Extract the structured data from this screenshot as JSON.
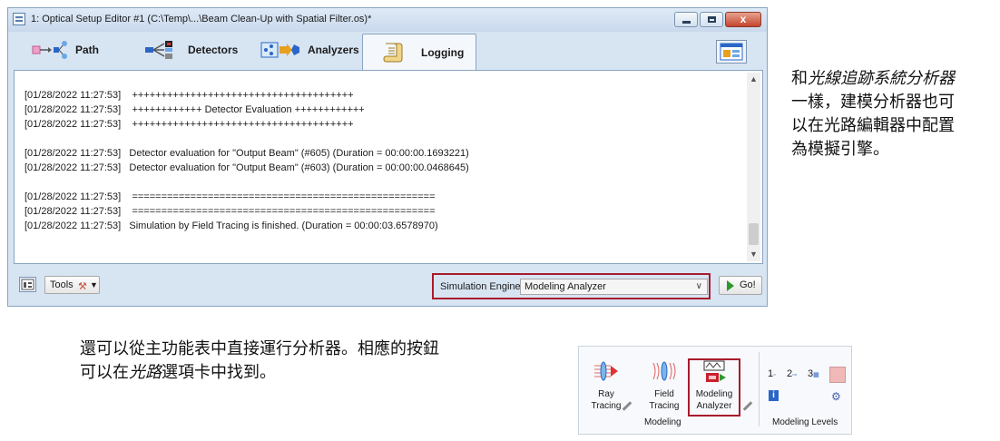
{
  "window": {
    "title": "1: Optical Setup Editor #1 (C:\\Temp\\...\\Beam Clean-Up with Spatial Filter.os)*",
    "close_glyph": "x"
  },
  "tabs": [
    {
      "label": "Path",
      "icon": "path-icon"
    },
    {
      "label": "Detectors",
      "icon": "detectors-icon"
    },
    {
      "label": "Analyzers",
      "icon": "analyzers-icon"
    },
    {
      "label": "Logging",
      "icon": "logging-scroll-icon",
      "active": true
    }
  ],
  "log": {
    "lines": [
      "[01/28/2022 11:27:53]    ++++++++++++++++++++++++++++++++++++++",
      "[01/28/2022 11:27:53]    ++++++++++++ Detector Evaluation ++++++++++++",
      "[01/28/2022 11:27:53]    ++++++++++++++++++++++++++++++++++++++",
      "",
      "[01/28/2022 11:27:53]   Detector evaluation for \"Output Beam\" (#605) (Duration = 00:00:00.1693221)",
      "[01/28/2022 11:27:53]   Detector evaluation for \"Output Beam\" (#603) (Duration = 00:00:00.0468645)",
      "",
      "[01/28/2022 11:27:53]    ====================================================",
      "[01/28/2022 11:27:53]    ====================================================",
      "[01/28/2022 11:27:53]   Simulation by Field Tracing is finished. (Duration = 00:00:03.6578970)"
    ]
  },
  "bottombar": {
    "tools_label": "Tools",
    "engine_label": "Simulation Engine",
    "engine_value": "Modeling Analyzer",
    "go_label": "Go!"
  },
  "note_right": {
    "line1_prefix": "和",
    "line1_italic": "光線追跡系統分析器",
    "line2": "一樣，建模分析器也可",
    "line3": "以在光路編輯器中配置",
    "line4": "為模擬引擎。"
  },
  "note_bottom": {
    "line1": "還可以從主功能表中直接運行分析器。相應的按鈕",
    "line2_prefix": "可以在",
    "line2_italic": "光路",
    "line2_suffix": "選項卡中找到。"
  },
  "ribbon": {
    "ray_tracing": [
      "Ray",
      "Tracing"
    ],
    "field_tracing": [
      "Field",
      "Tracing"
    ],
    "modeling_analyzer": [
      "Modeling",
      "Analyzer"
    ],
    "group_modeling": "Modeling",
    "group_levels": "Modeling Levels",
    "level1": "1",
    "level2": "2",
    "level3": "3",
    "info_glyph": "i"
  },
  "colors": {
    "highlight": "#a91b2c",
    "go_green": "#2a9a2a",
    "window_bg": "#d7e4f2"
  }
}
